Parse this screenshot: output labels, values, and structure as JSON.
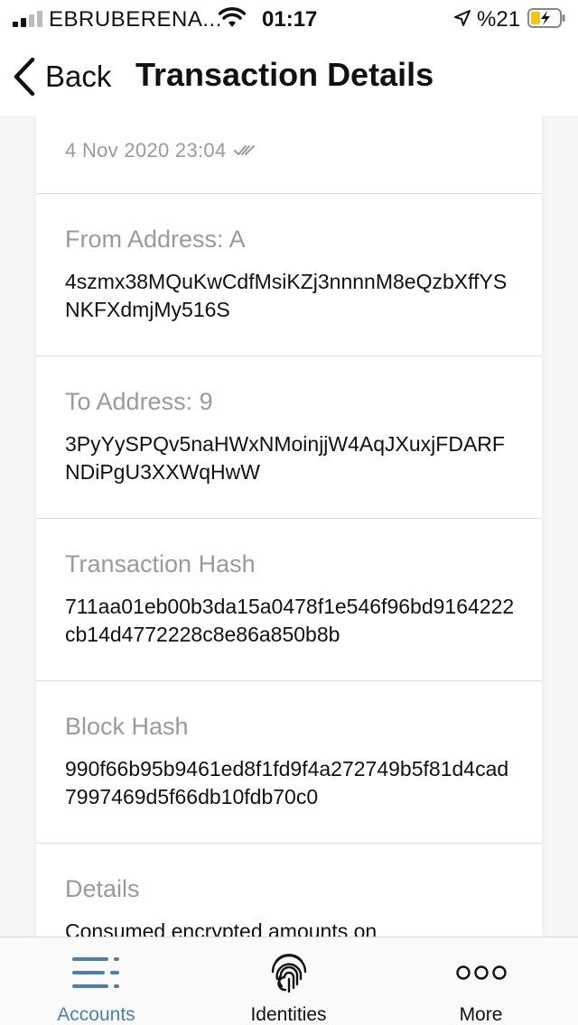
{
  "status_bar": {
    "carrier": "EBRUBERENA...",
    "time": "01:17",
    "battery_percent": "%21",
    "icons": [
      "signal-icon",
      "wifi-icon",
      "location-arrow-icon",
      "battery-charging-icon"
    ]
  },
  "nav": {
    "back_label": "Back",
    "title": "Transaction Details"
  },
  "transaction": {
    "date": "4 Nov 2020 23:04"
  },
  "sections": [
    {
      "label": "From Address: A",
      "value": "4szmx38MQuKwCdfMsiKZj3nnnnM8eQzbXffYSNKFXdmjMy516S"
    },
    {
      "label": "To Address: 9",
      "value": "3PyYySPQv5naHWxNMoinjjW4AqJXuxjFDARFNDiPgU3XXWqHwW"
    },
    {
      "label": "Transaction Hash",
      "value": "711aa01eb00b3da15a0478f1e546f96bd9164222cb14d4772228c8e86a850b8b"
    },
    {
      "label": "Block Hash",
      "value": "990f66b95b9461ed8f1fd9f4a272749b5f81d4cad7997469d5f66db10fdb70c0"
    },
    {
      "label": "Details",
      "value": "Consumed encrypted amounts on"
    }
  ],
  "tabs": [
    {
      "label": "Accounts",
      "icon": "accounts-list-icon",
      "active": true
    },
    {
      "label": "Identities",
      "icon": "fingerprint-icon",
      "active": false
    },
    {
      "label": "More",
      "icon": "more-dots-icon",
      "active": false
    }
  ],
  "colors": {
    "accent": "#4f7fa8",
    "muted_text": "#9a9a9a",
    "divider": "#dcdcdc"
  }
}
